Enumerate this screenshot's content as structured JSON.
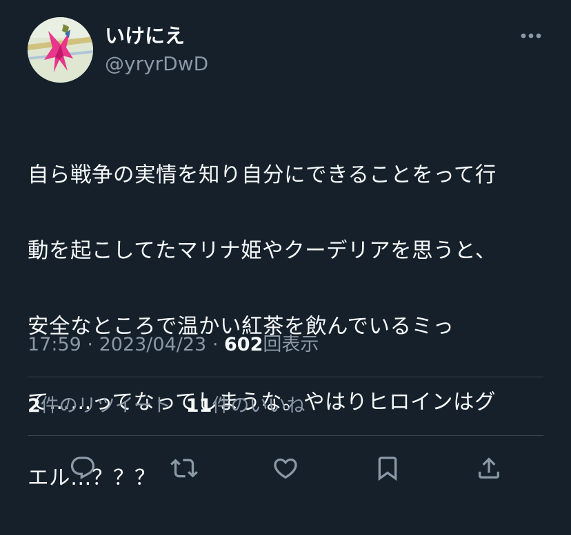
{
  "user": {
    "display_name": "いけにえ",
    "handle": "@yryrDwD"
  },
  "tweet": {
    "lines": [
      "自ら戦争の実情を知り自分にできることをって行",
      "動を起こしてたマリナ姫やクーデリアを思うと、",
      "安全なところで温かい紅茶を飲んでいるミっ",
      "て……ってなってしまうな。やはりヒロインはグ",
      "エル…？？？"
    ]
  },
  "meta": {
    "time": "17:59",
    "separator": "·",
    "date": "2023/04/23",
    "views_count": "602",
    "views_label": "回表示"
  },
  "stats": {
    "retweets_count": "2",
    "retweets_label": "件のリツイート",
    "likes_count": "11",
    "likes_label": "件のいいね"
  },
  "actions": {
    "icons": [
      "reply-icon",
      "retweet-icon",
      "like-icon",
      "bookmark-icon",
      "share-icon"
    ],
    "icon_color": "#8b98a5"
  },
  "colors": {
    "background": "#15202b",
    "text": "#f7f9f9",
    "secondary": "#8b98a5",
    "divider": "#38444d"
  }
}
